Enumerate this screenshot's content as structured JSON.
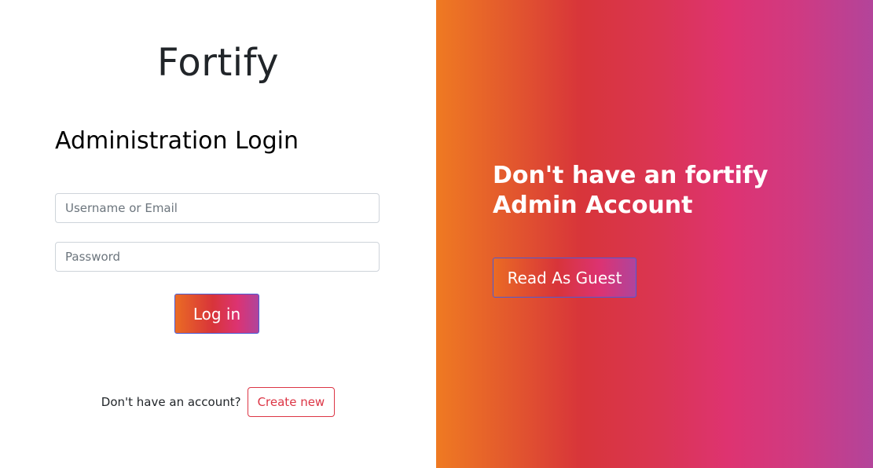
{
  "login_panel": {
    "brand": "Fortify",
    "heading": "Administration Login",
    "username_placeholder": "Username or Email",
    "password_placeholder": "Password",
    "login_button": "Log in",
    "signup_prompt": "Don't have an account?",
    "create_button": "Create new"
  },
  "guest_panel": {
    "heading": "Don't have an fortify Admin Account",
    "guest_button": "Read As Guest"
  },
  "colors": {
    "gradient": [
      "#ef7a22",
      "#d8353a",
      "#de3371",
      "#b3449a"
    ],
    "button_border": "#4b5bd6",
    "create_button": "#dc3545",
    "text_dark": "#212529"
  }
}
